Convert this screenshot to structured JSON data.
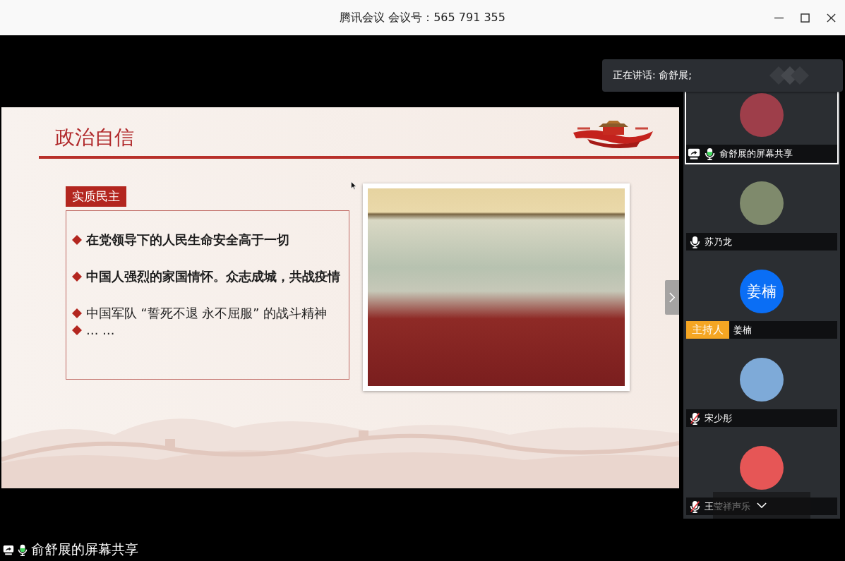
{
  "window": {
    "title": "腾讯会议 会议号：565 791 355"
  },
  "slide": {
    "title": "政治自信",
    "section": "实质民主",
    "bullets": [
      {
        "text": "在党领导下的人民生命安全高于一切",
        "bold": true
      },
      {
        "text": "中国人强烈的家国情怀。众志成城，共战疫情",
        "bold": true
      },
      {
        "text": "中国军队 “誓死不退 永不屈服” 的战斗精神",
        "bold": false
      },
      {
        "text": "… …",
        "bold": false
      }
    ]
  },
  "speaking": {
    "label": "正在讲话: 俞舒展;"
  },
  "participants": [
    {
      "name": "俞舒展的屏幕共享",
      "selected": true,
      "sharing": true,
      "mic": {
        "muted": false,
        "speaking": true
      },
      "avatar": {
        "kind": "photo",
        "color": "#9e3e4a"
      }
    },
    {
      "name": "苏乃龙",
      "selected": false,
      "sharing": false,
      "mic": {
        "muted": false,
        "speaking": false
      },
      "avatar": {
        "kind": "photo",
        "color": "#7f8a6c"
      }
    },
    {
      "name": "姜楠",
      "selected": false,
      "sharing": false,
      "badge": "主持人",
      "avatar": {
        "kind": "initials",
        "text": "姜楠",
        "color": "#0a6ef5"
      }
    },
    {
      "name": "宋少彤",
      "selected": false,
      "sharing": false,
      "mic": {
        "muted": true,
        "speaking": false
      },
      "avatar": {
        "kind": "photo",
        "color": "#7eaad8"
      }
    },
    {
      "name": "王莹祥声乐",
      "selected": false,
      "sharing": false,
      "mic": {
        "muted": true,
        "speaking": false
      },
      "avatar": {
        "kind": "photo",
        "color": "#e65656"
      }
    }
  ],
  "screen_share": {
    "label": "俞舒展的屏幕共享",
    "sharing": true,
    "mic": {
      "muted": false,
      "speaking": true
    }
  }
}
